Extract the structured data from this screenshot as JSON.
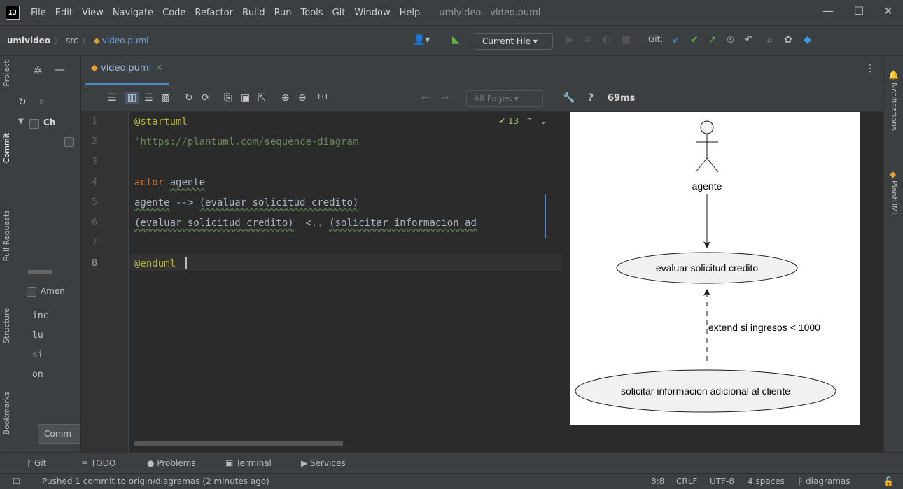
{
  "app": {
    "logo": "IJ",
    "window_title": "umlvideo - video.puml",
    "menu": [
      "File",
      "Edit",
      "View",
      "Navigate",
      "Code",
      "Refactor",
      "Build",
      "Run",
      "Tools",
      "Git",
      "Window",
      "Help"
    ]
  },
  "navbar": {
    "project": "umlvideo",
    "folder": "src",
    "file": "video.puml",
    "run_config": "Current File ▾",
    "git_label": "Git:"
  },
  "left_strip": {
    "tabs": [
      "Project",
      "Commit",
      "Pull Requests",
      "Structure",
      "Bookmarks"
    ]
  },
  "right_strip": {
    "tabs": [
      "Notifications",
      "PlantUML"
    ]
  },
  "commit_panel": {
    "changes_label": "Ch",
    "amend_label": "Amen",
    "fragments": [
      "inc",
      "lu",
      "si",
      "on"
    ],
    "commit_button": "Comm"
  },
  "editor": {
    "tab_name": "video.puml",
    "inspection_count": "13",
    "line_numbers": [
      "1",
      "2",
      "3",
      "4",
      "5",
      "6",
      "7",
      "8"
    ],
    "code": {
      "l1": "@startuml",
      "l2": "'https://plantuml.com/sequence-diagram",
      "l4_kw": "actor",
      "l4_id": "agente",
      "l5_a": "agente",
      "l5_arrow": " --> ",
      "l5_b": "(evaluar solicitud credito)",
      "l6_a": "(evaluar solicitud credito)",
      "l6_arrow": "  <.. ",
      "l6_b": "(solicitar informacion ad",
      "l8": "@enduml"
    }
  },
  "toolbar": {
    "zoom_label": "1:1",
    "pages_select": "All Pages ▾",
    "help": "?",
    "timing": "69ms"
  },
  "diagram": {
    "actor": "agente",
    "usecase1": "evaluar solicitud credito",
    "usecase2": "solicitar informacion adicional al cliente",
    "extend_label": "extend si ingresos < 1000"
  },
  "bottom_tabs": [
    "Git",
    "TODO",
    "Problems",
    "Terminal",
    "Services"
  ],
  "status": {
    "message": "Pushed 1 commit to origin/diagramas (2 minutes ago)",
    "position": "8:8",
    "line_sep": "CRLF",
    "encoding": "UTF-8",
    "indent": "4 spaces",
    "branch": "diagramas"
  },
  "icons": {
    "settings": "gear-icon",
    "refresh": "refresh-icon",
    "zoom_in": "zoom-in-icon",
    "zoom_out": "zoom-out-icon",
    "search": "search-icon",
    "build": "hammer-icon",
    "plantuml_file": "plantuml-file-icon"
  },
  "colors": {
    "accent": "#4a88c7",
    "keyword": "#cc7832",
    "annotation": "#bbb529",
    "string": "#6a8759",
    "git_update": "#3592c4",
    "git_commit": "#62b543"
  }
}
